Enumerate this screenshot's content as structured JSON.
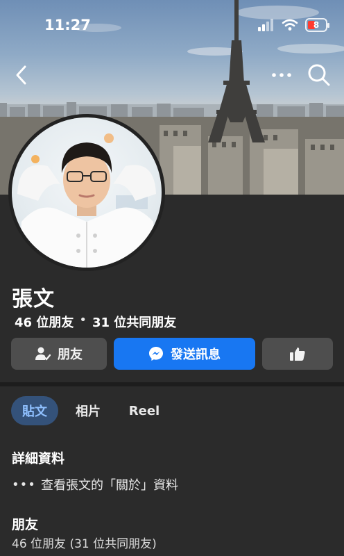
{
  "status_bar": {
    "time": "11:27",
    "battery": "8"
  },
  "profile": {
    "name": "張文",
    "friends_count": "46 位朋友",
    "separator": "•",
    "mutual_friends": "31 位共同朋友"
  },
  "actions": {
    "friends_label": "朋友",
    "message_label": "發送訊息"
  },
  "tabs": [
    {
      "label": "貼文",
      "selected": true
    },
    {
      "label": "相片",
      "selected": false
    },
    {
      "label": "Reel",
      "selected": false
    }
  ],
  "details": {
    "title": "詳細資料",
    "about_dots": "•••",
    "about_text": "查看張文的「關於」資料"
  },
  "friends_section": {
    "title": "朋友",
    "summary": "46 位朋友 (31 位共同朋友)"
  },
  "colors": {
    "accent": "#1877f2",
    "background": "#2b2b2b",
    "button_gray": "#4e4e4e",
    "tab_selected_bg": "#34527a",
    "tab_selected_text": "#8fc0ff"
  },
  "icons": {
    "back": "chevron-left-icon",
    "more": "more-horizontal-icon",
    "search": "search-icon",
    "friends": "person-check-icon",
    "messenger": "messenger-icon",
    "like": "thumbs-up-icon",
    "signal": "cellular-signal-icon",
    "wifi": "wifi-icon",
    "battery": "battery-icon"
  }
}
